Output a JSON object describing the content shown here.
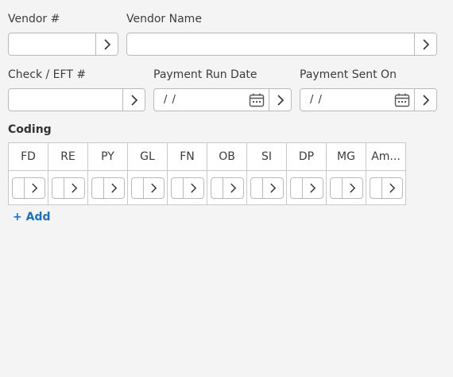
{
  "fields": {
    "vendor_number": {
      "label": "Vendor #",
      "value": ""
    },
    "vendor_name": {
      "label": "Vendor Name",
      "value": ""
    },
    "check_eft": {
      "label": "Check / EFT #",
      "value": ""
    },
    "payment_run_date": {
      "label": "Payment Run Date",
      "value": "/ /"
    },
    "payment_sent_on": {
      "label": "Payment Sent On",
      "value": "/ /"
    }
  },
  "coding": {
    "title": "Coding",
    "columns": [
      "FD",
      "RE",
      "PY",
      "GL",
      "FN",
      "OB",
      "SI",
      "DP",
      "MG",
      "Am..."
    ],
    "add_label": "+ Add"
  },
  "icons": {
    "chevron": "chevron-right-icon",
    "calendar": "calendar-icon"
  },
  "colors": {
    "accent": "#1f6fb5",
    "background": "#f4f4f4",
    "border": "#b9b9b9"
  }
}
